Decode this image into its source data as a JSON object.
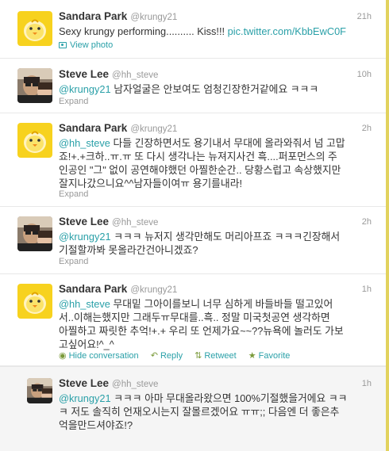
{
  "tweets": [
    {
      "name": "Sandara Park",
      "handle": "@krungy21",
      "time": "21h",
      "text_parts": [
        "Sexy krungy performing.......... Kiss!!! ",
        "pic.twitter.com/KbbEwC0F"
      ],
      "footer": "View photo"
    },
    {
      "name": "Steve Lee",
      "handle": "@hh_steve",
      "time": "10h",
      "mention": "@krungy21",
      "text": " 남자얼굴은 안보여도 엄청긴장한거같에요 ㅋㅋㅋ",
      "footer": "Expand"
    },
    {
      "name": "Sandara Park",
      "handle": "@krungy21",
      "time": "2h",
      "mention": "@hh_steve",
      "line1": " 다들 긴장하면서도 용기내서 무대에 올라와줘서 넘 고맙",
      "line2": "죠!+.+크하..ㅠ.ㅠ 또 다시 생각나는 뉴져지사건 흑....퍼포먼스의 주",
      "line3": "인공인 \"그\" 없이 공연해야했던 아찔한순간.. 당황스럽고 속상했지만",
      "line4": "잘지나갔으니요^^남자들이여ㅠ 용기를내라!",
      "footer": "Expand"
    },
    {
      "name": "Steve Lee",
      "handle": "@hh_steve",
      "time": "2h",
      "mention": "@krungy21",
      "line1": " ㅋㅋㅋ 뉴저지 생각만해도 머리아프죠 ㅋㅋㅋ긴장해서",
      "line2": "기절할까봐 못올라간건아니겠죠?",
      "footer": "Expand"
    },
    {
      "name": "Sandara Park",
      "handle": "@krungy21",
      "time": "1h",
      "mention": "@hh_steve",
      "line1": " 무대밑 그아이를보니 너무 심하게 바들바들 떨고있어",
      "line2": "서..이해는했지만 그래두ㅠ무대를..흑.. 정말 미국첫공연 생각하면",
      "line3": "아찔하고 짜릿한 추억!+.+ 우리 또 언제가요~~??뉴욕에 놀러도 가보",
      "line4": "고싶어요!^_^",
      "actions": {
        "hide": "Hide conversation",
        "reply": "Reply",
        "retweet": "Retweet",
        "favorite": "Favorite"
      }
    },
    {
      "name": "Steve Lee",
      "handle": "@hh_steve",
      "time": "1h",
      "mention": "@krungy21",
      "line1": " ㅋㅋㅋ 아마 무대올라왔으면 100%기절했을거에요 ㅋㅋ",
      "line2": "ㅋ 저도 솔직히 언재오시는지 잘몰르겠어요 ㅠㅠ;; 다음엔 더 좋은추",
      "line3": "억을만드셔야죠!?"
    }
  ],
  "icons": {
    "chick_avatar": "yellow-chick-avatar",
    "steve_avatar": "steve-lee-photo-avatar"
  },
  "colors": {
    "link": "#2aa0a8",
    "background": "#f5ee86"
  }
}
